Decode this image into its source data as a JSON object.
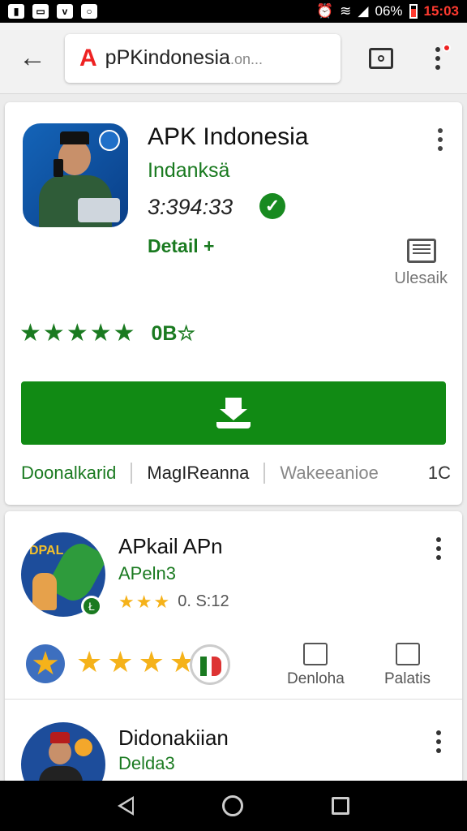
{
  "status_bar": {
    "battery_percent": "06%",
    "time": "15:03",
    "icons": [
      "notification-icon-1",
      "notification-icon-2",
      "notification-icon-3",
      "notification-icon-4",
      "alarm-icon",
      "wifi-icon",
      "signal-icon",
      "battery-icon"
    ]
  },
  "toolbar": {
    "url_text": "pPKindonesia",
    "url_suffix": ".on...",
    "site_badge": "A"
  },
  "app": {
    "title": "APK Indonesia",
    "developer": "Indanksä",
    "size": "3:394:33",
    "detail": "Detail +",
    "review_label": "Ulesaik",
    "rating_text": "0B☆",
    "tabs": [
      "Doonalkarid",
      "MagIReanna",
      "Wakeeanioe"
    ],
    "tab_number": "1C"
  },
  "related": [
    {
      "title": "APkail APn",
      "developer": "APeln3",
      "rating_text": "0. S:12",
      "icon_text": "DPAL",
      "actions": [
        "Denloha",
        "Palatis"
      ]
    },
    {
      "title": "Didonakiian",
      "developer": "Delda3"
    }
  ],
  "colors": {
    "accent_green": "#118a14",
    "text_green": "#1a7a20",
    "star_gold": "#f5b21a",
    "time_red": "#ff3b30"
  }
}
